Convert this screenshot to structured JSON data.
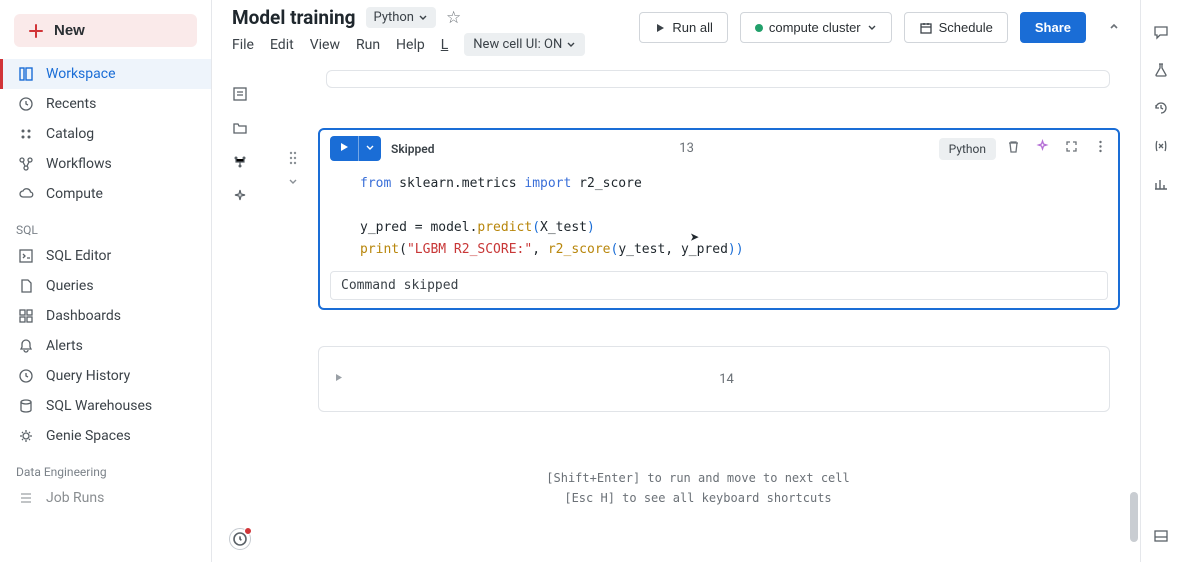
{
  "sidebar": {
    "new_label": "New",
    "main_items": [
      {
        "label": "Workspace",
        "icon": "workspace"
      },
      {
        "label": "Recents",
        "icon": "clock"
      },
      {
        "label": "Catalog",
        "icon": "catalog"
      },
      {
        "label": "Workflows",
        "icon": "workflows"
      },
      {
        "label": "Compute",
        "icon": "cloud"
      }
    ],
    "sql_label": "SQL",
    "sql_items": [
      {
        "label": "SQL Editor",
        "icon": "sql-editor"
      },
      {
        "label": "Queries",
        "icon": "queries"
      },
      {
        "label": "Dashboards",
        "icon": "dashboards"
      },
      {
        "label": "Alerts",
        "icon": "alerts"
      },
      {
        "label": "Query History",
        "icon": "clock"
      },
      {
        "label": "SQL Warehouses",
        "icon": "warehouses"
      },
      {
        "label": "Genie Spaces",
        "icon": "genie"
      }
    ],
    "de_label": "Data Engineering",
    "de_items": [
      {
        "label": "Job Runs",
        "icon": "job-runs"
      }
    ]
  },
  "header": {
    "title": "Model training",
    "language": "Python",
    "menu": [
      "File",
      "Edit",
      "View",
      "Run",
      "Help"
    ],
    "last_edit_shortcut": "L",
    "cell_ui_label": "New cell UI: ON",
    "run_all": "Run all",
    "cluster": "compute cluster",
    "schedule": "Schedule",
    "share": "Share"
  },
  "cell": {
    "status": "Skipped",
    "number": "13",
    "language_badge": "Python",
    "code_tokens": {
      "from": "from",
      "pkg": "sklearn.metrics",
      "import_kw": "import",
      "r2": "r2_score",
      "assign": "y_pred = model.",
      "predict": "predict",
      "xtest": "X_test",
      "print": "print",
      "str": "\"LGBM R2_SCORE:\"",
      "comma": ", ",
      "call2_fn": "r2_score",
      "ytest": "y_test",
      "ypred": "y_pred"
    },
    "output": "Command skipped"
  },
  "next_cell_number": "14",
  "hints": {
    "line1": "[Shift+Enter] to run and move to next cell",
    "line2": "[Esc H] to see all keyboard shortcuts"
  }
}
